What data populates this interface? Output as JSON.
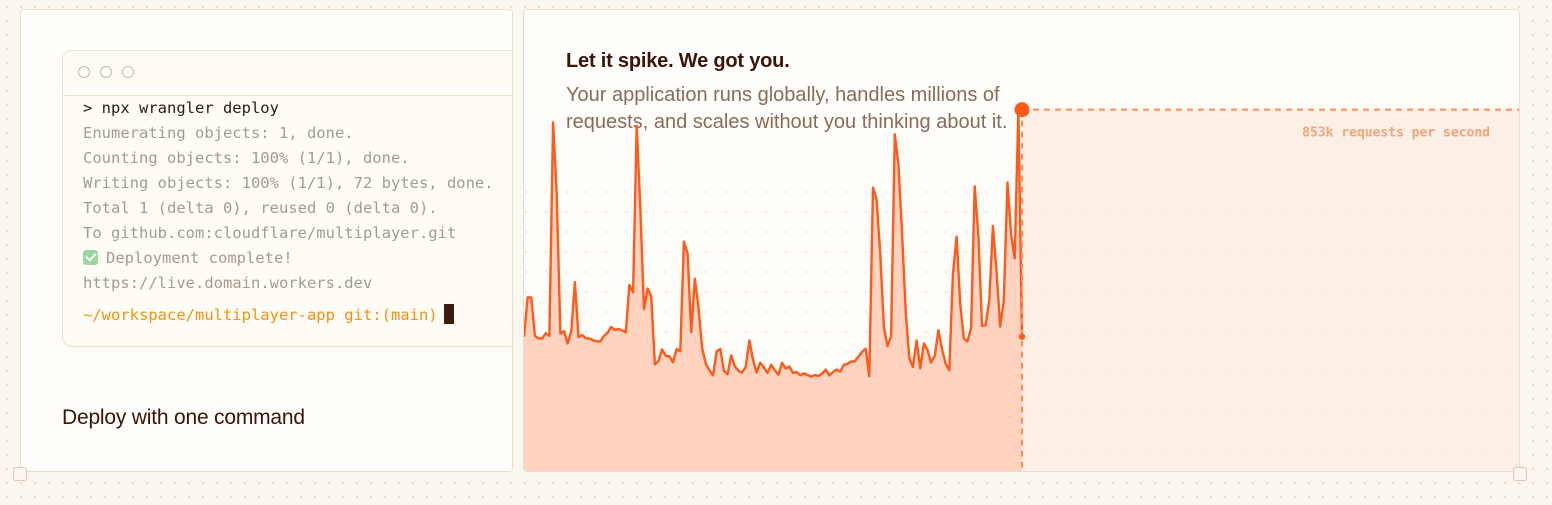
{
  "deploy_card": {
    "title": "Deploy with one command",
    "terminal": {
      "command": "> npx wrangler deploy",
      "output_lines": [
        "Enumerating objects: 1, done.",
        "Counting objects: 100% (1/1), done.",
        "Writing objects: 100% (1/1), 72 bytes, done.",
        "Total 1 (delta 0), reused 0 (delta 0).",
        "To github.com:cloudflare/multiplayer.git"
      ],
      "success_line": "Deployment complete!",
      "url_line": "https://live.domain.workers.dev",
      "prompt": "~/workspace/multiplayer-app git:(main)"
    }
  },
  "scale_card": {
    "headline": "Let it spike. We got you.",
    "subtext": "Your application runs globally, handles millions of requests, and scales without you thinking about it.",
    "chart_data": {
      "type": "area",
      "title": "",
      "xlabel": "",
      "ylabel": "",
      "grid": true,
      "peak_annotation": "853k requests per second",
      "peak_value": 853,
      "ylim": [
        0,
        1000
      ],
      "values": [
        320,
        412,
        412,
        322,
        316,
        316,
        328,
        322,
        823,
        655,
        327,
        333,
        304,
        333,
        448,
        319,
        324,
        316,
        316,
        312,
        309,
        309,
        322,
        329,
        343,
        336,
        338,
        335,
        330,
        441,
        424,
        815,
        623,
        385,
        433,
        415,
        255,
        263,
        290,
        275,
        274,
        260,
        291,
        286,
        543,
        515,
        331,
        456,
        388,
        294,
        256,
        241,
        229,
        286,
        291,
        240,
        232,
        276,
        251,
        240,
        236,
        249,
        311,
        266,
        236,
        259,
        248,
        235,
        254,
        241,
        231,
        259,
        245,
        250,
        235,
        237,
        229,
        234,
        230,
        226,
        230,
        228,
        233,
        243,
        229,
        237,
        243,
        238,
        254,
        256,
        262,
        262,
        273,
        284,
        292,
        227,
        670,
        642,
        516,
        343,
        298,
        321,
        795,
        724,
        566,
        379,
        270,
        249,
        311,
        246,
        304,
        289,
        259,
        276,
        335,
        291,
        256,
        241,
        466,
        555,
        397,
        316,
        309,
        341,
        673,
        555,
        345,
        347,
        405,
        580,
        471,
        344,
        405,
        682,
        560,
        504,
        853,
        320
      ]
    }
  },
  "colors": {
    "accent": "#ff5a1a",
    "area_fill": "#ffd3bf",
    "heading": "#3a1408",
    "prompt": "#f29210"
  }
}
